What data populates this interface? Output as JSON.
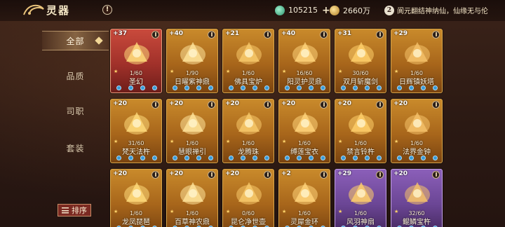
{
  "header": {
    "title": "灵器",
    "help_label": "!",
    "jade_amount": "105215",
    "plus_label": "+",
    "gold_amount": "2660万",
    "notice_number": "2",
    "notice_text": "阆元翻结神纳仙，仙缘无与伦"
  },
  "sidebar": {
    "tabs": [
      {
        "label": "全部",
        "active": true
      },
      {
        "label": "品质",
        "active": false
      },
      {
        "label": "司职",
        "active": false
      },
      {
        "label": "套装",
        "active": false
      }
    ],
    "sort_label": "排序"
  },
  "cards": [
    {
      "level": "+37",
      "count": "1/60",
      "name": "圣幻",
      "rarity": "red"
    },
    {
      "level": "+40",
      "count": "1/90",
      "name": "日曜紫神鼎",
      "rarity": "gold"
    },
    {
      "level": "+21",
      "count": "1/60",
      "name": "佛具宝炉",
      "rarity": "gold"
    },
    {
      "level": "+40",
      "count": "16/60",
      "name": "阳灵护灵鼎",
      "rarity": "gold"
    },
    {
      "level": "+31",
      "count": "30/60",
      "name": "双月斩魔剑",
      "rarity": "gold"
    },
    {
      "level": "+29",
      "count": "1/60",
      "name": "日辉镇妖塔",
      "rarity": "gold"
    },
    {
      "level": "+20",
      "count": "31/60",
      "name": "梵天法杵",
      "rarity": "gold"
    },
    {
      "level": "+20",
      "count": "1/60",
      "name": "慧眼禅引",
      "rarity": "gold"
    },
    {
      "level": "+20",
      "count": "1/60",
      "name": "龙腾珠",
      "rarity": "gold"
    },
    {
      "level": "+20",
      "count": "1/60",
      "name": "缚莲宝衣",
      "rarity": "gold"
    },
    {
      "level": "+20",
      "count": "1/60",
      "name": "禁言铃杵",
      "rarity": "gold"
    },
    {
      "level": "+20",
      "count": "1/60",
      "name": "法界金钟",
      "rarity": "gold"
    },
    {
      "level": "+20",
      "count": "1/60",
      "name": "龙凤琵琶",
      "rarity": "gold"
    },
    {
      "level": "+20",
      "count": "1/60",
      "name": "百草神农鼎",
      "rarity": "gold"
    },
    {
      "level": "+20",
      "count": "0/60",
      "name": "昆仑净世壶",
      "rarity": "gold"
    },
    {
      "level": "+2",
      "count": "1/60",
      "name": "灵犀金环",
      "rarity": "gold"
    },
    {
      "level": "+29",
      "count": "1/60",
      "name": "风羽神扇",
      "rarity": "purple"
    },
    {
      "level": "+20",
      "count": "32/60",
      "name": "鲲鳞宝杵",
      "rarity": "purple"
    }
  ],
  "colors": {
    "gold_card": "#b5731f",
    "red_card": "#b23a30",
    "purple_card": "#7a52a6",
    "accent": "#f2d796"
  }
}
